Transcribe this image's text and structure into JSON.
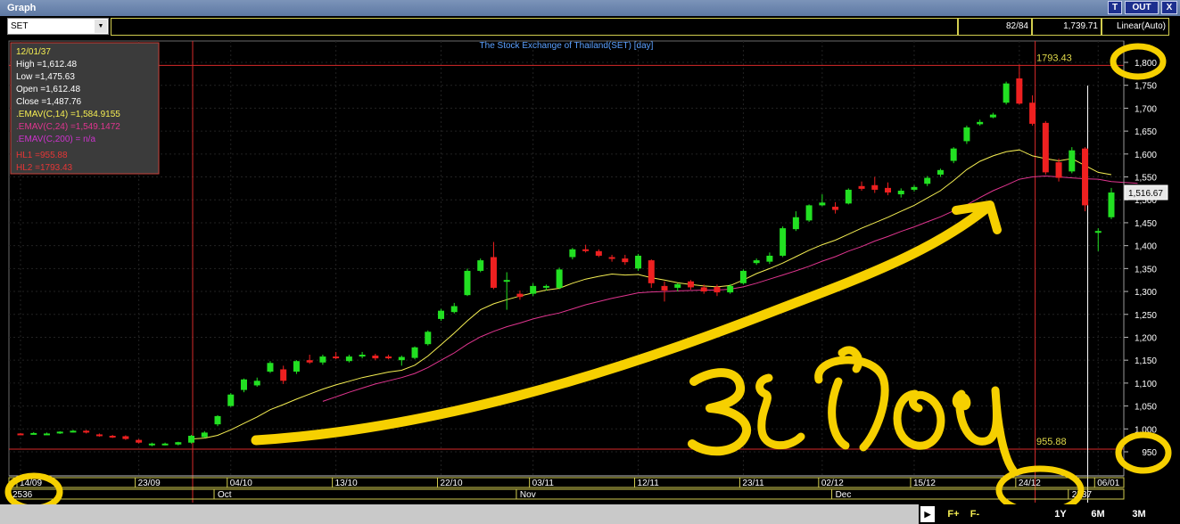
{
  "window": {
    "title": "Graph",
    "buttons": [
      "T",
      "OUT",
      "X"
    ]
  },
  "toolbar": {
    "symbol": "SET",
    "bars_shown": "82/84",
    "last_value": "1,739.71",
    "scale_mode": "Linear(Auto)"
  },
  "info_box": {
    "date": "12/01/37",
    "lines": [
      {
        "text": "High  =1,612.48",
        "color": "#ffffff"
      },
      {
        "text": "Low  =1,475.63",
        "color": "#ffffff"
      },
      {
        "text": "Open  =1,612.48",
        "color": "#ffffff"
      },
      {
        "text": "Close  =1,487.76",
        "color": "#ffffff"
      },
      {
        "text": ".EMAV(C,14)   =1,584.9155",
        "color": "#f5ee52"
      },
      {
        "text": ".EMAV(C,24)   =1,549.1472",
        "color": "#e0358f"
      },
      {
        "text": ".EMAV(C,200)   = n/a",
        "color": "#cc33cc"
      },
      {
        "text": "HL1 =955.88",
        "color": "#e63636"
      },
      {
        "text": "HL2 =1793.43",
        "color": "#e63636"
      }
    ]
  },
  "bottom_bar": {
    "buttons": [
      "F+",
      "F-",
      "1Y",
      "6M",
      "3M"
    ]
  },
  "annotation": {
    "handwritten_text": "3 เดือน"
  },
  "chart_data": {
    "type": "candlestick",
    "title": "The Stock Exchange of Thailand(SET) [day]",
    "ylim": [
      940,
      1830
    ],
    "yticks": [
      950,
      1000,
      1050,
      1100,
      1150,
      1200,
      1250,
      1300,
      1350,
      1400,
      1450,
      1500,
      1550,
      1600,
      1650,
      1700,
      1750,
      1800
    ],
    "x_date_labels": [
      "14/09",
      "23/09",
      "04/10",
      "13/10",
      "22/10",
      "03/11",
      "12/11",
      "23/11",
      "02/12",
      "15/12",
      "24/12",
      "06/01"
    ],
    "x_period_labels": [
      "2536",
      "Oct",
      "Nov",
      "Dec",
      "2537"
    ],
    "current_price_label": "1,516.67",
    "horizontal_lines": [
      {
        "name": "HL1",
        "value": 955.88,
        "label": "955.88"
      },
      {
        "name": "HL2",
        "value": 1793.43,
        "label": "1793.43"
      }
    ],
    "series": [
      {
        "name": "SET",
        "ohlc": [
          [
            990,
            991,
            988,
            989
          ],
          [
            990,
            993,
            988,
            991
          ],
          [
            989,
            992,
            987,
            990
          ],
          [
            991,
            995,
            989,
            994
          ],
          [
            994,
            998,
            992,
            996
          ],
          [
            996,
            998,
            990,
            992
          ],
          [
            988,
            990,
            983,
            985
          ],
          [
            985,
            987,
            980,
            983
          ],
          [
            984,
            986,
            976,
            978
          ],
          [
            976,
            978,
            968,
            970
          ],
          [
            965,
            970,
            962,
            968
          ],
          [
            966,
            970,
            964,
            968
          ],
          [
            966,
            972,
            964,
            971
          ],
          [
            970,
            987,
            968,
            985
          ],
          [
            982,
            995,
            980,
            992
          ],
          [
            1010,
            1030,
            1006,
            1028
          ],
          [
            1050,
            1078,
            1048,
            1075
          ],
          [
            1085,
            1110,
            1080,
            1108
          ],
          [
            1095,
            1112,
            1092,
            1105
          ],
          [
            1125,
            1148,
            1122,
            1144
          ],
          [
            1130,
            1138,
            1098,
            1105
          ],
          [
            1125,
            1150,
            1120,
            1148
          ],
          [
            1150,
            1162,
            1142,
            1145
          ],
          [
            1145,
            1162,
            1140,
            1158
          ],
          [
            1158,
            1168,
            1152,
            1156
          ],
          [
            1148,
            1162,
            1145,
            1158
          ],
          [
            1158,
            1168,
            1154,
            1162
          ],
          [
            1160,
            1164,
            1150,
            1154
          ],
          [
            1158,
            1162,
            1152,
            1155
          ],
          [
            1150,
            1160,
            1138,
            1157
          ],
          [
            1155,
            1180,
            1152,
            1178
          ],
          [
            1185,
            1215,
            1182,
            1212
          ],
          [
            1240,
            1262,
            1236,
            1258
          ],
          [
            1255,
            1275,
            1252,
            1268
          ],
          [
            1292,
            1350,
            1290,
            1345
          ],
          [
            1345,
            1372,
            1342,
            1368
          ],
          [
            1375,
            1408,
            1305,
            1308
          ],
          [
            1322,
            1342,
            1260,
            1325
          ],
          [
            1295,
            1302,
            1282,
            1288
          ],
          [
            1295,
            1318,
            1290,
            1312
          ],
          [
            1310,
            1315,
            1302,
            1312
          ],
          [
            1308,
            1352,
            1305,
            1348
          ],
          [
            1375,
            1395,
            1370,
            1392
          ],
          [
            1392,
            1402,
            1385,
            1388
          ],
          [
            1388,
            1392,
            1375,
            1378
          ],
          [
            1375,
            1380,
            1365,
            1372
          ],
          [
            1372,
            1380,
            1358,
            1364
          ],
          [
            1350,
            1382,
            1345,
            1378
          ],
          [
            1368,
            1370,
            1308,
            1318
          ],
          [
            1312,
            1322,
            1278,
            1302
          ],
          [
            1308,
            1318,
            1300,
            1316
          ],
          [
            1322,
            1325,
            1304,
            1309
          ],
          [
            1309,
            1315,
            1295,
            1300
          ],
          [
            1310,
            1315,
            1290,
            1298
          ],
          [
            1298,
            1316,
            1295,
            1312
          ],
          [
            1318,
            1348,
            1315,
            1345
          ],
          [
            1362,
            1372,
            1358,
            1368
          ],
          [
            1365,
            1385,
            1360,
            1378
          ],
          [
            1378,
            1442,
            1375,
            1438
          ],
          [
            1436,
            1475,
            1432,
            1462
          ],
          [
            1455,
            1490,
            1452,
            1488
          ],
          [
            1488,
            1512,
            1486,
            1494
          ],
          [
            1485,
            1495,
            1470,
            1478
          ],
          [
            1492,
            1525,
            1490,
            1522
          ],
          [
            1530,
            1540,
            1520,
            1524
          ],
          [
            1532,
            1550,
            1515,
            1522
          ],
          [
            1526,
            1538,
            1510,
            1516
          ],
          [
            1512,
            1525,
            1505,
            1520
          ],
          [
            1522,
            1532,
            1518,
            1528
          ],
          [
            1535,
            1552,
            1530,
            1548
          ],
          [
            1555,
            1568,
            1550,
            1565
          ],
          [
            1585,
            1615,
            1580,
            1612
          ],
          [
            1628,
            1662,
            1622,
            1658
          ],
          [
            1665,
            1675,
            1662,
            1670
          ],
          [
            1680,
            1690,
            1678,
            1686
          ],
          [
            1712,
            1758,
            1708,
            1754
          ],
          [
            1765,
            1795,
            1708,
            1710
          ],
          [
            1712,
            1728,
            1662,
            1666
          ],
          [
            1668,
            1672,
            1555,
            1560
          ],
          [
            1582,
            1590,
            1540,
            1548
          ],
          [
            1562,
            1615,
            1558,
            1608
          ],
          [
            1612,
            1615,
            1475,
            1488
          ],
          [
            1428,
            1438,
            1388,
            1432
          ],
          [
            1462,
            1526,
            1458,
            1516
          ]
        ]
      },
      {
        "name": ".EMAV(C,14)",
        "color": "#f5ee52",
        "values": [
          null,
          null,
          null,
          null,
          null,
          null,
          null,
          null,
          null,
          null,
          null,
          null,
          null,
          978,
          980,
          986,
          998,
          1012,
          1026,
          1042,
          1053,
          1065,
          1076,
          1087,
          1096,
          1104,
          1112,
          1118,
          1124,
          1128,
          1139,
          1159,
          1184,
          1209,
          1236,
          1260,
          1273,
          1282,
          1290,
          1297,
          1303,
          1307,
          1318,
          1327,
          1333,
          1338,
          1336,
          1337,
          1330,
          1325,
          1319,
          1315,
          1312,
          1310,
          1313,
          1325,
          1339,
          1350,
          1362,
          1376,
          1390,
          1402,
          1412,
          1425,
          1438,
          1450,
          1462,
          1475,
          1488,
          1504,
          1520,
          1542,
          1566,
          1584,
          1596,
          1605,
          1609,
          1596,
          1590,
          1585,
          1590,
          1575,
          1560,
          1555
        ]
      },
      {
        "name": ".EMAV(C,24)",
        "color": "#e0358f",
        "values": [
          null,
          null,
          null,
          null,
          null,
          null,
          null,
          null,
          null,
          null,
          null,
          null,
          null,
          null,
          null,
          null,
          null,
          null,
          null,
          null,
          null,
          null,
          null,
          1060,
          1070,
          1080,
          1089,
          1098,
          1105,
          1112,
          1121,
          1134,
          1150,
          1166,
          1185,
          1201,
          1213,
          1223,
          1231,
          1240,
          1247,
          1253,
          1262,
          1271,
          1278,
          1285,
          1291,
          1297,
          1299,
          1300,
          1301,
          1302,
          1303,
          1303,
          1305,
          1310,
          1318,
          1327,
          1336,
          1345,
          1355,
          1366,
          1376,
          1388,
          1398,
          1410,
          1420,
          1431,
          1441,
          1452,
          1463,
          1476,
          1489,
          1505,
          1520,
          1532,
          1545,
          1550,
          1552,
          1550,
          1548,
          1546,
          1545,
          1540,
          1538,
          1536
        ]
      }
    ]
  }
}
